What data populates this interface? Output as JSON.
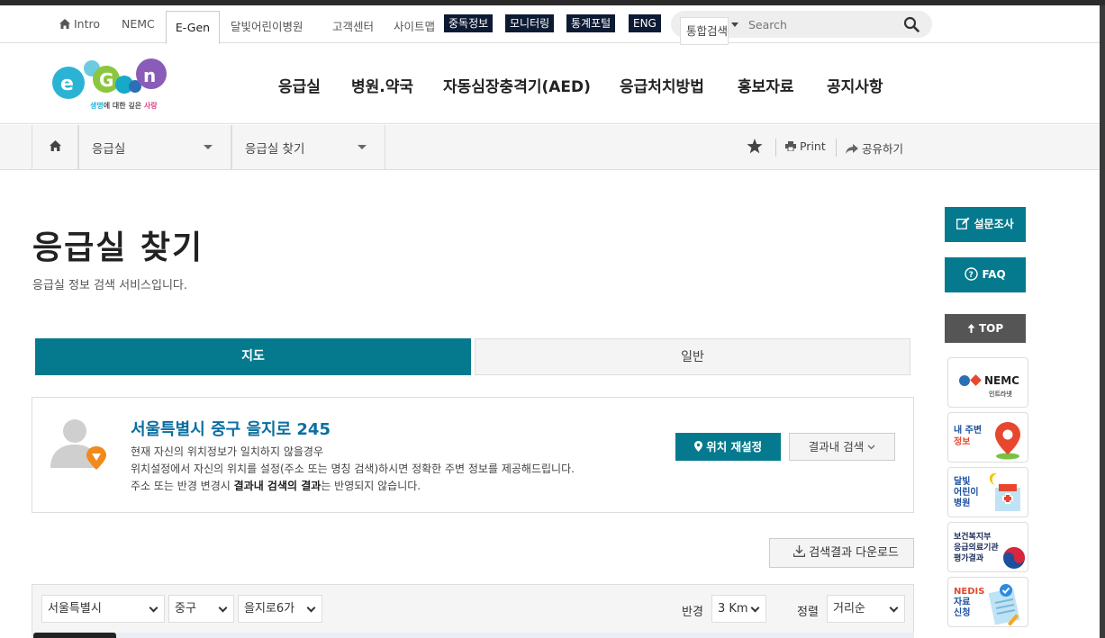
{
  "utility": {
    "intro": "Intro",
    "nemc": "NEMC",
    "egen": "E-Gen",
    "child_hospital": "달빛어린이병원",
    "customer_center": "고객센터",
    "sitemap": "사이트맵",
    "poison_info": "중독정보",
    "monitoring": "모니터링",
    "stats_portal": "통계포털",
    "eng": "ENG",
    "search_scope": "통합검색",
    "search_placeholder": "Search"
  },
  "logo": {
    "tagline_1": "생명",
    "tagline_2": "에 대한 깊은 ",
    "tagline_3": "사랑"
  },
  "nav": [
    "응급실",
    "병원.약국",
    "자동심장충격기(AED)",
    "응급처치방법",
    "홍보자료",
    "공지사항"
  ],
  "breadcrumb": {
    "level1": "응급실",
    "level2": "응급실 찾기",
    "print": "Print",
    "share": "공유하기"
  },
  "page": {
    "title": "응급실 찾기",
    "subtitle": "응급실 정보 검색 서비스입니다."
  },
  "tabs": {
    "map": "지도",
    "general": "일반"
  },
  "location": {
    "address": "서울특별시 중구 을지로 245",
    "line1": "현재 자신의 위치정보가 일치하지 않을경우",
    "line2": "위치설정에서 자신의 위치를 설정(주소 또는 명칭 검색)하시면 정확한 주변 정보를 제공해드립니다.",
    "line3_pre": "주소 또는 반경 변경시 ",
    "line3_bold": "결과내 검색의 결과",
    "line3_post": "는 반영되지 않습니다.",
    "reset_button": "위치 재설정",
    "within_button": "결과내 검색"
  },
  "download_button": "검색결과 다운로드",
  "filters": {
    "city": "서울특별시",
    "district": "중구",
    "dong": "을지로6가",
    "radius_label": "반경",
    "radius": "3 Km",
    "sort_label": "정렬",
    "sort": "거리순"
  },
  "quick_menu": {
    "survey": "설문조사",
    "faq": "FAQ",
    "top": "TOP",
    "nemc_title": "NEMC",
    "nemc_sub": "인트라넷",
    "nearby_1": "내 주변",
    "nearby_2": "정보",
    "child_1": "달빛",
    "child_2": "어린이",
    "child_3": "병원",
    "mohw_1": "보건복지부",
    "mohw_2": "응급의료기관",
    "mohw_3": "평가결과",
    "nedis_1": "NEDIS",
    "nedis_2": "자료",
    "nedis_3": "신청"
  },
  "colors": {
    "accent": "#057a8e",
    "dark_badge": "#0c1a33",
    "address_blue": "#0a6fa0",
    "pin_orange": "#f08a1c"
  }
}
